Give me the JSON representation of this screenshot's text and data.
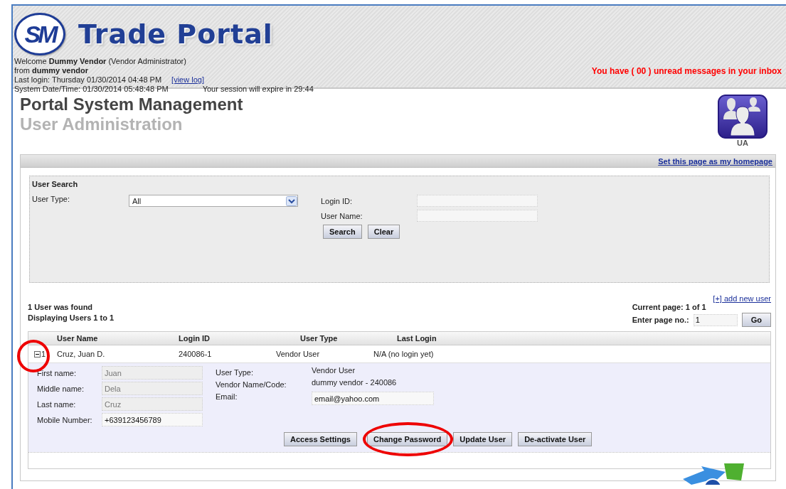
{
  "header": {
    "logo": "SM",
    "title": "Trade Portal",
    "welcome": "Welcome **Dummy Vendor** (Vendor Administrator)",
    "from": "from **dummy vendor**",
    "last_login": "Last login: Thursday 01/30/2014 04:48 PM",
    "view_log": "[view log]",
    "system_time": "System Date/Time: 01/30/2014 05:48:48 PM",
    "session": "Your session will expire in 29:44",
    "messages": "You have ( 00 ) unread messages in your inbox"
  },
  "page": {
    "title": "Portal System Management",
    "subtitle": "User Administration",
    "module_label": "UA"
  },
  "homepage_link": "Set this page as my homepage",
  "search": {
    "title": "User Search",
    "user_type_label": "User Type:",
    "user_type_value": "All",
    "login_id_label": "Login ID:",
    "user_name_label": "User Name:",
    "buttons": [
      "Search",
      "Clear"
    ]
  },
  "results": {
    "found": "1 User was found",
    "displaying": "Displaying Users 1 to 1",
    "add_user": "[+] add new user",
    "current_page": "Current page: 1 of 1",
    "enter_page_label": "Enter page no.:",
    "page_value": "1",
    "go": "Go"
  },
  "table": {
    "columns": [
      "User Name",
      "Login ID",
      "User Type",
      "Last Login"
    ],
    "rows": [
      {
        "index": "1",
        "expanded": true,
        "circled": true,
        "cells": [
          "Cruz, Juan D.",
          "240086-1",
          "Vendor User",
          "N/A (no login yet)"
        ],
        "details": {
          "left": [
            {
              "label": "First name:",
              "value": "Juan",
              "readonly": true
            },
            {
              "label": "Middle name:",
              "value": "Dela",
              "readonly": true
            },
            {
              "label": "Last name:",
              "value": "Cruz",
              "readonly": true
            },
            {
              "label": "Mobile Number:",
              "value": "+639123456789",
              "readonly": false
            }
          ],
          "right": [
            {
              "kind": "text",
              "label": "User Type:",
              "value": "Vendor User"
            },
            {
              "kind": "text",
              "label": "Vendor Name/Code:",
              "value": "dummy vendor - 240086"
            },
            {
              "kind": "field",
              "label": "Email:",
              "value": "email@yahoo.com"
            }
          ],
          "buttons": [
            {
              "label": "Access Settings",
              "circled": false
            },
            {
              "label": "Change Password",
              "circled": true
            },
            {
              "label": "Update User",
              "circled": false
            },
            {
              "label": "De-activate User",
              "circled": false
            }
          ]
        }
      }
    ]
  }
}
